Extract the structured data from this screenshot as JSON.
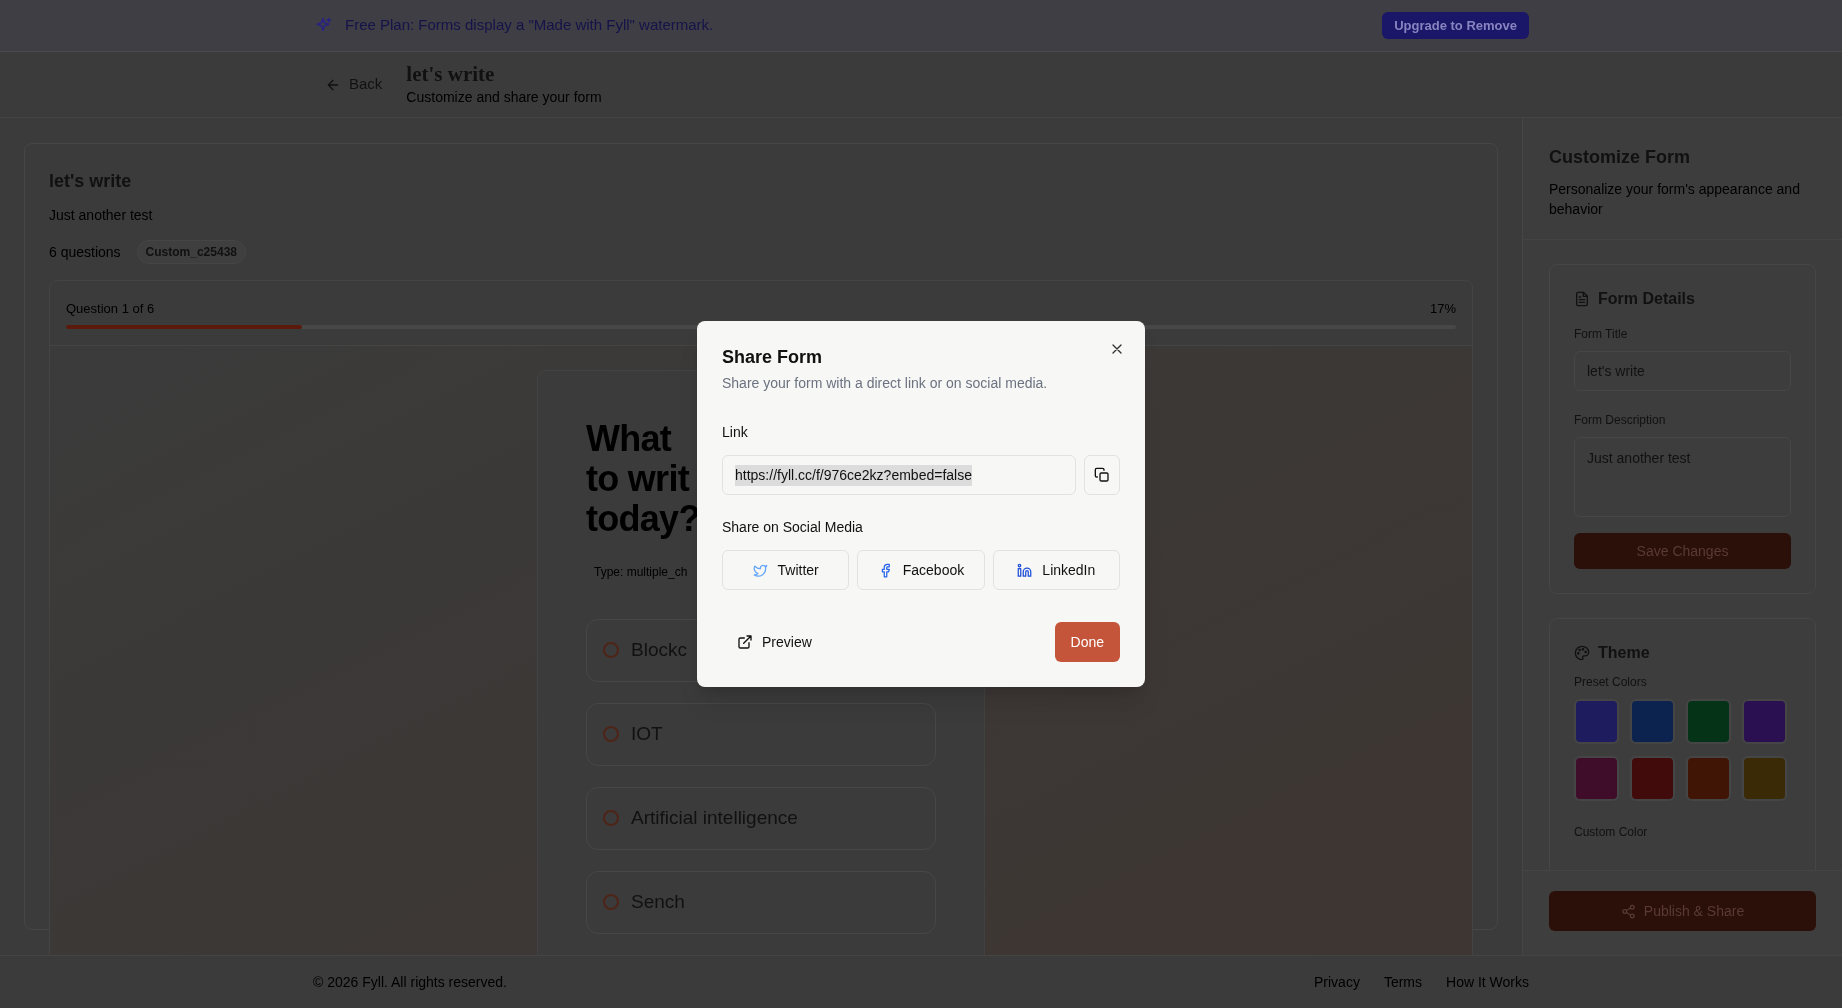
{
  "banner": {
    "text": "Free Plan: Forms display a \"Made with Fyll\" watermark.",
    "button": "Upgrade to Remove"
  },
  "header": {
    "back": "Back",
    "title": "let's write",
    "subtitle": "Customize and share your form"
  },
  "form_card": {
    "title": "let's write",
    "description": "Just another test",
    "count": "6 questions",
    "badge": "Custom_c25438",
    "progress": {
      "label": "Question 1 of 6",
      "percent": "17%",
      "level": 0.17
    },
    "question": {
      "lines": [
        "What",
        "to writ",
        "today?"
      ],
      "type": "Type: multiple_ch",
      "options": [
        {
          "label": "Blockc",
          "selected": false
        },
        {
          "label": "IOT",
          "selected": false
        },
        {
          "label": "Artificial intelligence",
          "selected": false
        },
        {
          "label": "Sench",
          "selected": false
        }
      ]
    }
  },
  "sidebar": {
    "title": "Customize Form",
    "description": "Personalize your form's appearance and behavior",
    "details": {
      "heading": "Form Details",
      "title_label": "Form Title",
      "title_value": "let's write",
      "description_label": "Form Description",
      "description_value": "Just another test",
      "save": "Save Changes"
    },
    "theme": {
      "heading": "Theme",
      "preset_label": "Preset Colors",
      "presets": [
        {
          "color": "#1e1b5e"
        },
        {
          "color": "#0c2350"
        },
        {
          "color": "#053318"
        },
        {
          "color": "#2a1050"
        },
        {
          "color": "#3f0c2a"
        },
        {
          "color": "#420b0b"
        },
        {
          "color": "#411505"
        },
        {
          "color": "#3b2a06"
        }
      ],
      "custom_label": "Custom Color"
    },
    "publish": "Publish & Share"
  },
  "modal": {
    "title": "Share Form",
    "description": "Share your form with a direct link or on social media.",
    "link_label": "Link",
    "link": "https://fyll.cc/f/976ce2kz?embed=false",
    "link_highlighted": true,
    "social_label": "Share on Social Media",
    "social": [
      {
        "kind": "twitter",
        "label": "Twitter"
      },
      {
        "kind": "facebook",
        "label": "Facebook"
      },
      {
        "kind": "linkedin",
        "label": "LinkedIn"
      }
    ],
    "preview": "Preview",
    "done": "Done"
  },
  "footer": {
    "copyright": "© 2026 Fyll. All rights reserved.",
    "links": [
      "Privacy",
      "Terms",
      "How It Works"
    ]
  }
}
